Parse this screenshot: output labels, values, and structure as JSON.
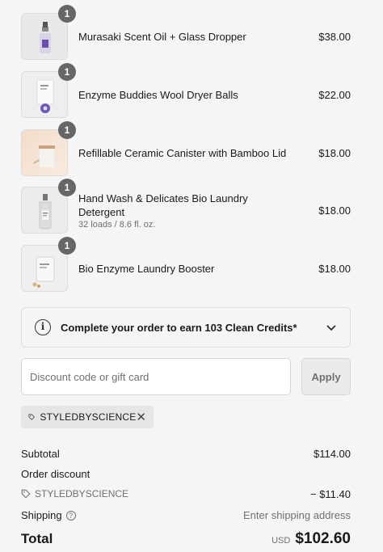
{
  "items": [
    {
      "name": "Murasaki Scent Oil + Glass Dropper",
      "variant": "",
      "price": "$38.00",
      "qty": "1"
    },
    {
      "name": "Enzyme Buddies Wool Dryer Balls",
      "variant": "",
      "price": "$22.00",
      "qty": "1"
    },
    {
      "name": "Refillable Ceramic Canister with Bamboo Lid",
      "variant": "",
      "price": "$18.00",
      "qty": "1"
    },
    {
      "name": "Hand Wash & Delicates Bio Laundry Detergent",
      "variant": "32 loads / 8.6 fl. oz.",
      "price": "$18.00",
      "qty": "1"
    },
    {
      "name": "Bio Enzyme Laundry Booster",
      "variant": "",
      "price": "$18.00",
      "qty": "1"
    }
  ],
  "credits": {
    "text": "Complete your order to earn 103 Clean Credits*",
    "icon": "info-icon"
  },
  "discount": {
    "placeholder": "Discount code or gift card",
    "value": "",
    "apply_label": "Apply"
  },
  "applied_code": {
    "code": "STYLEDBYSCIENCE",
    "remove_glyph": "✕"
  },
  "summary": {
    "subtotal_label": "Subtotal",
    "subtotal_value": "$114.00",
    "order_discount_label": "Order discount",
    "discount_code": "STYLEDBYSCIENCE",
    "discount_value": "− $11.40",
    "shipping_label": "Shipping",
    "shipping_value": "Enter shipping address",
    "total_label": "Total",
    "currency": "USD",
    "total_value": "$102.60"
  }
}
